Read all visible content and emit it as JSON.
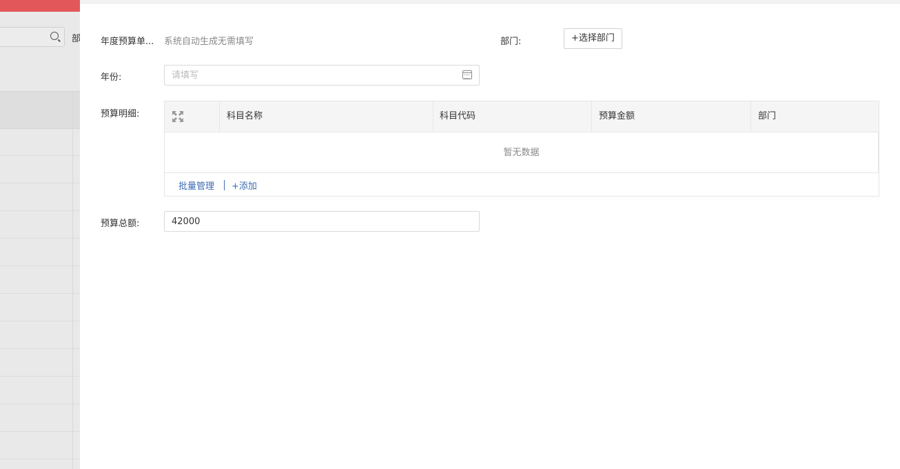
{
  "background": {
    "partial_label": "部",
    "search_placeholder": ""
  },
  "form": {
    "doc_no_label": "年度预算单...",
    "doc_no_value": "系统自动生成无需填写",
    "dept_label": "部门:",
    "dept_button": "+选择部门",
    "year_label": "年份:",
    "year_placeholder": "请填写",
    "detail_label": "预算明细:",
    "total_label": "预算总额:",
    "total_value": "42000"
  },
  "detail_table": {
    "columns": [
      "科目名称",
      "科目代码",
      "预算金额",
      "部门"
    ],
    "empty_text": "暂无数据",
    "batch_manage": "批量管理",
    "add": "+添加"
  },
  "colors": {
    "topbar_red": "#e2585a",
    "link_blue": "#3d6bb3"
  }
}
